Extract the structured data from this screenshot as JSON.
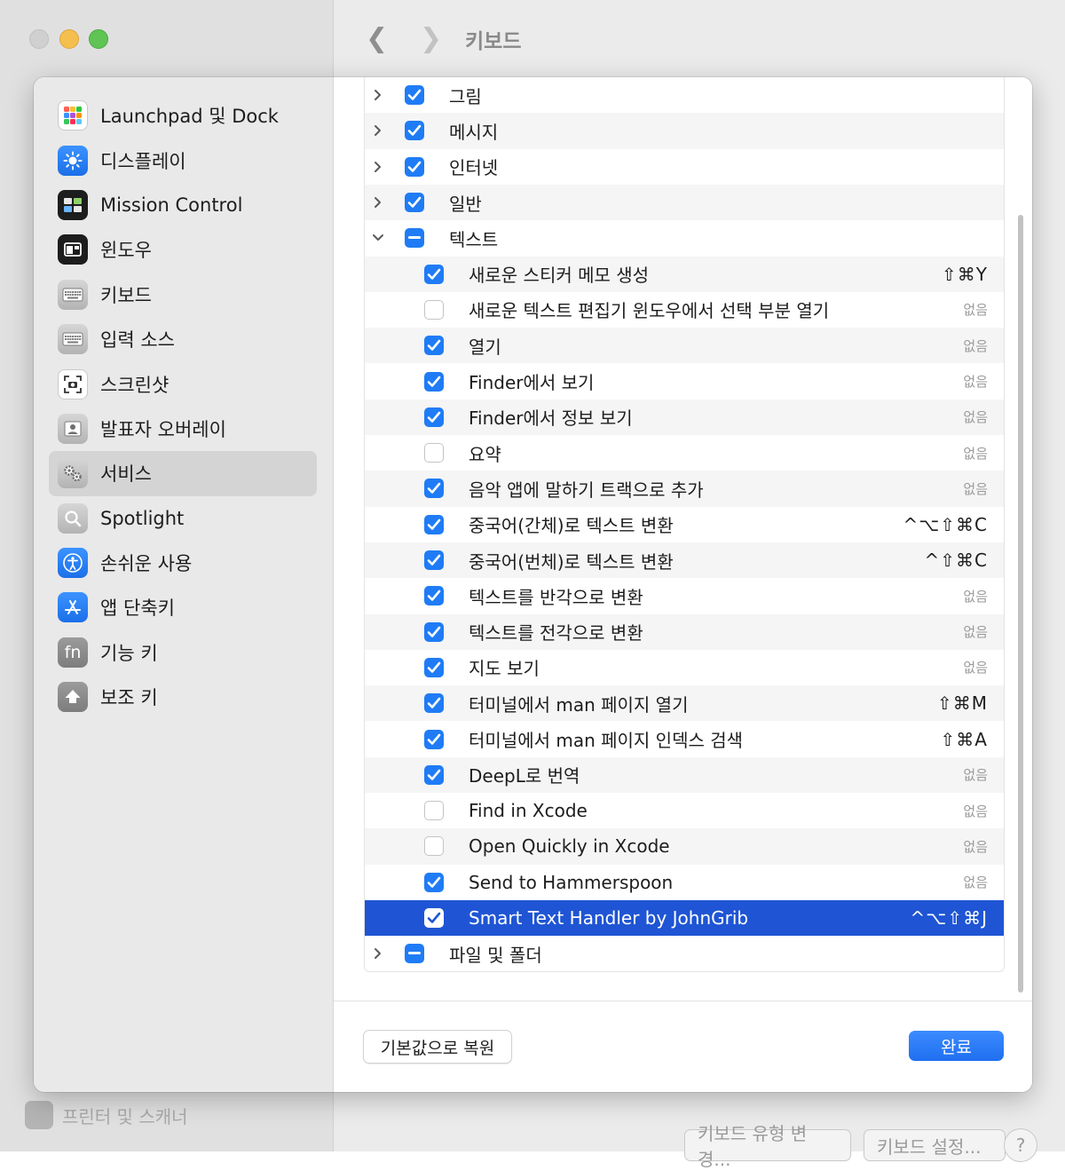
{
  "window": {
    "title": "키보드"
  },
  "background": {
    "bottom_item": "프린터 및 스캐너",
    "buttons": {
      "keyboard_type": "키보드 유형 변경...",
      "keyboard_setup": "키보드 설정...",
      "help": "?"
    }
  },
  "sidebar": {
    "items": [
      {
        "label": "Launchpad 및 Dock",
        "icon": "launchpad-icon"
      },
      {
        "label": "디스플레이",
        "icon": "display-icon"
      },
      {
        "label": "Mission Control",
        "icon": "mission-control-icon"
      },
      {
        "label": "윈도우",
        "icon": "windows-icon"
      },
      {
        "label": "키보드",
        "icon": "keyboard-icon"
      },
      {
        "label": "입력 소스",
        "icon": "input-sources-icon"
      },
      {
        "label": "스크린샷",
        "icon": "screenshot-icon"
      },
      {
        "label": "발표자 오버레이",
        "icon": "presenter-overlay-icon"
      },
      {
        "label": "서비스",
        "icon": "services-icon",
        "selected": true
      },
      {
        "label": "Spotlight",
        "icon": "spotlight-icon"
      },
      {
        "label": "손쉬운 사용",
        "icon": "accessibility-icon"
      },
      {
        "label": "앱 단축키",
        "icon": "app-shortcuts-icon"
      },
      {
        "label": "기능 키",
        "icon": "function-keys-icon",
        "glyph": "fn"
      },
      {
        "label": "보조 키",
        "icon": "modifier-keys-icon"
      }
    ]
  },
  "services": {
    "rows": [
      {
        "label": "그림",
        "state": "checked",
        "group": true,
        "expanded": false
      },
      {
        "label": "메시지",
        "state": "checked",
        "group": true,
        "expanded": false
      },
      {
        "label": "인터넷",
        "state": "checked",
        "group": true,
        "expanded": false
      },
      {
        "label": "일반",
        "state": "checked",
        "group": true,
        "expanded": false
      },
      {
        "label": "텍스트",
        "state": "mixed",
        "group": true,
        "expanded": true
      },
      {
        "label": "새로운 스티커 메모 생성",
        "state": "checked",
        "shortcut": "⇧⌘Y"
      },
      {
        "label": "새로운 텍스트 편집기 윈도우에서 선택 부분 열기",
        "state": "unchecked",
        "shortcut": "없음"
      },
      {
        "label": "열기",
        "state": "checked",
        "shortcut": "없음"
      },
      {
        "label": "Finder에서 보기",
        "state": "checked",
        "shortcut": "없음"
      },
      {
        "label": "Finder에서 정보 보기",
        "state": "checked",
        "shortcut": "없음"
      },
      {
        "label": "요약",
        "state": "unchecked",
        "shortcut": "없음"
      },
      {
        "label": "음악 앱에 말하기 트랙으로 추가",
        "state": "checked",
        "shortcut": "없음"
      },
      {
        "label": "중국어(간체)로 텍스트 변환",
        "state": "checked",
        "shortcut": "^⌥⇧⌘C"
      },
      {
        "label": "중국어(번체)로 텍스트 변환",
        "state": "checked",
        "shortcut": "^⇧⌘C"
      },
      {
        "label": "텍스트를 반각으로 변환",
        "state": "checked",
        "shortcut": "없음"
      },
      {
        "label": "텍스트를 전각으로 변환",
        "state": "checked",
        "shortcut": "없음"
      },
      {
        "label": "지도 보기",
        "state": "checked",
        "shortcut": "없음"
      },
      {
        "label": "터미널에서 man 페이지 열기",
        "state": "checked",
        "shortcut": "⇧⌘M"
      },
      {
        "label": "터미널에서 man 페이지 인덱스 검색",
        "state": "checked",
        "shortcut": "⇧⌘A"
      },
      {
        "label": "DeepL로 번역",
        "state": "checked",
        "shortcut": "없음"
      },
      {
        "label": "Find in Xcode",
        "state": "unchecked",
        "shortcut": "없음"
      },
      {
        "label": "Open Quickly in Xcode",
        "state": "unchecked",
        "shortcut": "없음"
      },
      {
        "label": "Send to Hammerspoon",
        "state": "checked",
        "shortcut": "없음"
      },
      {
        "label": "Smart Text Handler by JohnGrib",
        "state": "checked",
        "shortcut": "^⌥⇧⌘J",
        "selected": true
      },
      {
        "label": "파일 및 폴더",
        "state": "mixed",
        "group": true,
        "expanded": false
      }
    ]
  },
  "footer": {
    "restore_label": "기본값으로 복원",
    "done_label": "완료"
  },
  "colors": {
    "accent": "#1f7cf6",
    "selection": "#1f55d4"
  }
}
